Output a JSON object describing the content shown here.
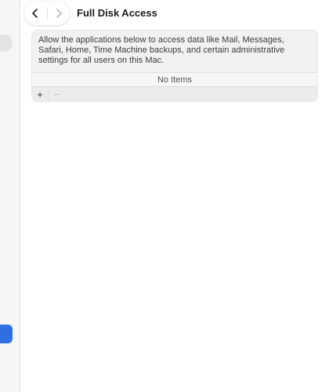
{
  "header": {
    "title": "Full Disk Access",
    "back_icon": "chevron-left-icon",
    "forward_icon": "chevron-right-icon"
  },
  "content": {
    "description": "Allow the applications below to access data like Mail, Messages, Safari, Home, Time Machine backups, and certain administrative settings for all users on this Mac.",
    "list_empty_text": "No Items",
    "add_label": "+",
    "remove_label": "−"
  },
  "colors": {
    "accent": "#2f6fe4",
    "group_background": "#f1f1f1",
    "window_background": "#ffffff"
  }
}
